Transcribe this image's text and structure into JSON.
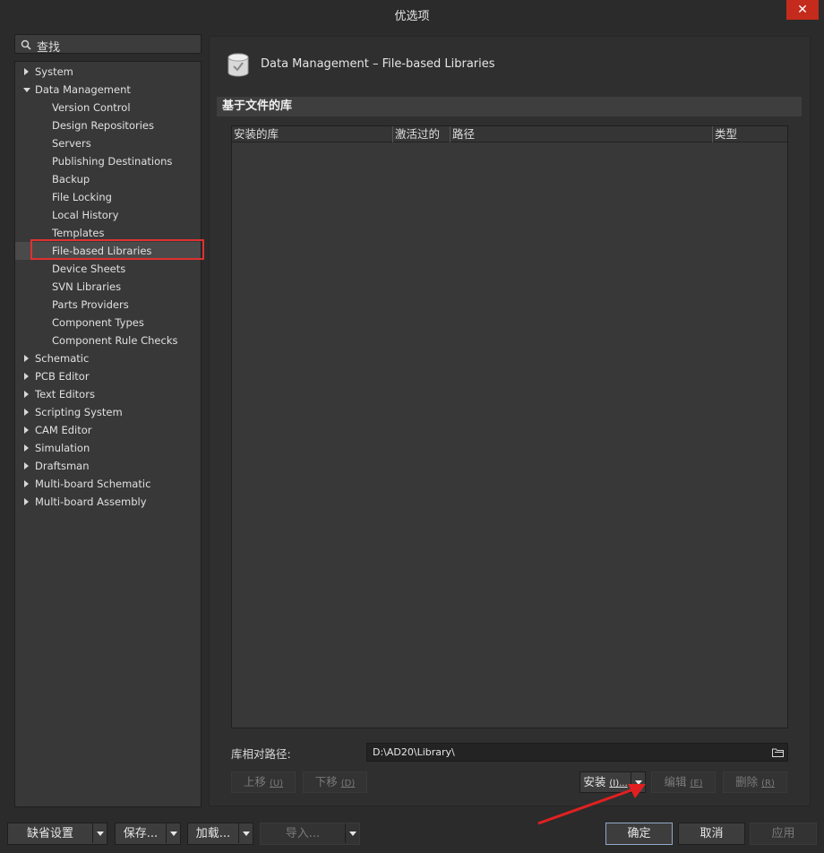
{
  "window": {
    "title": "优选项",
    "close_glyph": "✕"
  },
  "search": {
    "label": "查找"
  },
  "tree": {
    "items": [
      {
        "label": "System",
        "level": 0,
        "arrow": "right"
      },
      {
        "label": "Data Management",
        "level": 0,
        "arrow": "down"
      },
      {
        "label": "Version Control",
        "level": 1
      },
      {
        "label": "Design Repositories",
        "level": 1
      },
      {
        "label": "Servers",
        "level": 1
      },
      {
        "label": "Publishing Destinations",
        "level": 1
      },
      {
        "label": "Backup",
        "level": 1
      },
      {
        "label": "File Locking",
        "level": 1
      },
      {
        "label": "Local History",
        "level": 1
      },
      {
        "label": "Templates",
        "level": 1
      },
      {
        "label": "File-based Libraries",
        "level": 1,
        "selected": true
      },
      {
        "label": "Device Sheets",
        "level": 1
      },
      {
        "label": "SVN Libraries",
        "level": 1
      },
      {
        "label": "Parts Providers",
        "level": 1
      },
      {
        "label": "Component Types",
        "level": 1
      },
      {
        "label": "Component Rule Checks",
        "level": 1
      },
      {
        "label": "Schematic",
        "level": 0,
        "arrow": "right"
      },
      {
        "label": "PCB Editor",
        "level": 0,
        "arrow": "right"
      },
      {
        "label": "Text Editors",
        "level": 0,
        "arrow": "right"
      },
      {
        "label": "Scripting System",
        "level": 0,
        "arrow": "right"
      },
      {
        "label": "CAM Editor",
        "level": 0,
        "arrow": "right"
      },
      {
        "label": "Simulation",
        "level": 0,
        "arrow": "right"
      },
      {
        "label": "Draftsman",
        "level": 0,
        "arrow": "right"
      },
      {
        "label": "Multi-board Schematic",
        "level": 0,
        "arrow": "right"
      },
      {
        "label": "Multi-board Assembly",
        "level": 0,
        "arrow": "right"
      }
    ]
  },
  "main": {
    "page_title": "Data Management – File-based Libraries",
    "section_header": "基于文件的库",
    "table": {
      "columns": [
        "安装的库",
        "激活过的",
        "路径",
        "类型"
      ],
      "rows": []
    },
    "path_label": "库相对路径:",
    "path_value": "D:\\AD20\\Library\\",
    "buttons": {
      "move_up": "上移",
      "move_up_key": "(U)",
      "move_down": "下移",
      "move_down_key": "(D)",
      "install": "安装",
      "install_key": "(I)...",
      "edit": "编辑",
      "edit_key": "(E)",
      "delete": "删除",
      "delete_key": "(R)"
    }
  },
  "footer": {
    "defaults": "缺省设置",
    "save": "保存...",
    "load": "加载...",
    "import": "导入...",
    "ok": "确定",
    "cancel": "取消",
    "apply": "应用"
  },
  "colors": {
    "highlight": "#e03030",
    "annotation_arrow": "#e02020",
    "close": "#c42b1c"
  }
}
